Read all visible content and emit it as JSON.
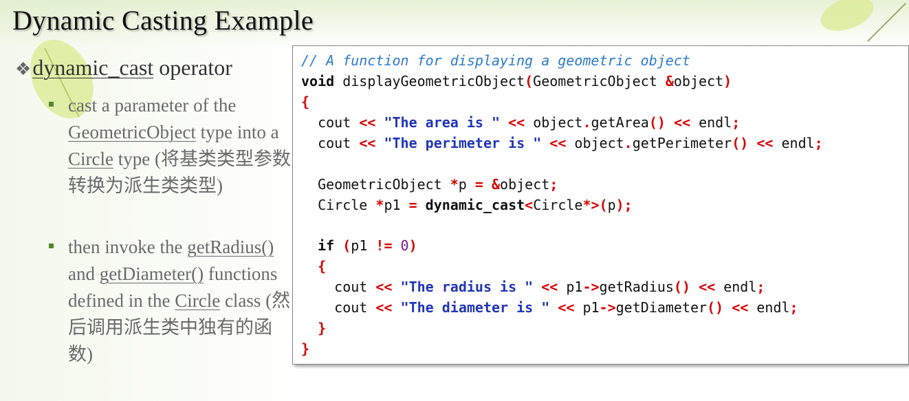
{
  "slide": {
    "title": "Dynamic Casting Example",
    "bullet_mark": "❖",
    "main_bullet": {
      "term": "dynamic_cast",
      "rest": " operator"
    },
    "sub1": {
      "t1": "cast a parameter of the ",
      "u1": "GeometricObject",
      "t2": " type into a ",
      "u2": "Circle",
      "t3": " type (将基类类型参数转换为派生类类型)"
    },
    "sub2": {
      "t1": "then invoke the ",
      "u1": "getRadius()",
      "t2": " and ",
      "u2": "getDiameter()",
      "t3": " functions defined in the ",
      "u3": "Circle",
      "t4": " class (然后调用派生类中独有的函数)"
    }
  },
  "code": {
    "comment": "// A function for displaying a geometric object",
    "sig_kw": "void",
    "sig_name": " displayGeometricObject",
    "sig_param": "GeometricObject ",
    "sig_obj": "object",
    "cout": "cout ",
    "str_area": "\"The area is \"",
    "str_perimeter": "\"The perimeter is \"",
    "call_area": " object",
    "get_area": "getArea",
    "get_perimeter": "getPerimeter",
    "endl": " endl",
    "decl_p_type": "GeometricObject ",
    "decl_p": "p ",
    "decl_p_obj": "object",
    "decl_p1_type": "Circle ",
    "decl_p1": "p1 ",
    "dc_kw": "dynamic_cast",
    "dc_type": "Circle",
    "dc_arg": "p",
    "if_kw": "if",
    "if_var": "p1 ",
    "zero": "0",
    "str_radius": "\"The radius is \"",
    "str_diameter": "\"The diameter is \"",
    "p1": " p1",
    "get_radius": "getRadius",
    "get_diameter": "getDiameter"
  },
  "colors": {
    "comment": "#2a79d0",
    "operator": "#d80000",
    "string": "#1f35b8",
    "number": "#7a1a8c",
    "bullet_square": "#4e8a2c"
  }
}
